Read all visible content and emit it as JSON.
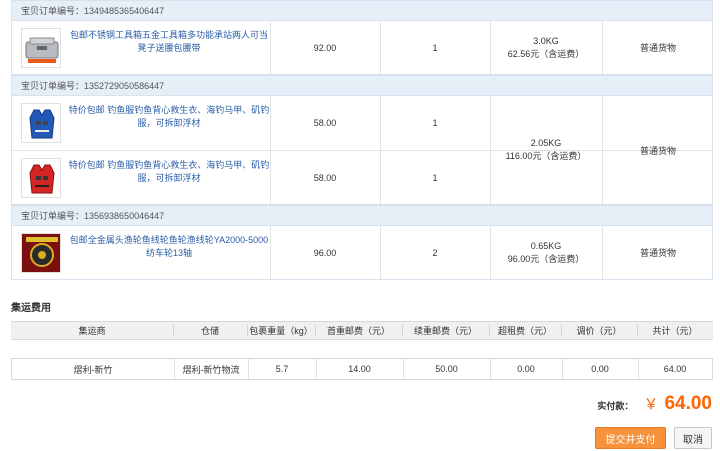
{
  "order_label": "宝贝订单编号：",
  "orders": [
    {
      "number": "1349485365406447",
      "items": [
        {
          "title": "包邮不锈钢工具箱五金工具箱多功能承站两人可当凳子送腰包腰带",
          "price": "92.00",
          "qty": "1",
          "icon": "toolbox-icon"
        }
      ],
      "weight": "3.0KG",
      "cost": "62.56元（含运费）",
      "type": "普通货物"
    },
    {
      "number": "1352729050586447",
      "items": [
        {
          "title": "特价包邮 钓鱼服钓鱼背心救生衣、海钓马甲、矶钓服，可拆卸浮材",
          "price": "58.00",
          "qty": "1",
          "icon": "blue-life-vest-icon"
        },
        {
          "title": "特价包邮 钓鱼服钓鱼背心救生衣、海钓马甲、矶钓服，可拆卸浮材",
          "price": "58.00",
          "qty": "1",
          "icon": "red-life-vest-icon"
        }
      ],
      "weight": "2.05KG",
      "cost": "116.00元（含运费）",
      "type": "普通货物"
    },
    {
      "number": "1356938650046447",
      "items": [
        {
          "title": "包邮全金属头渔轮鱼线轮鱼轮渔线轮YA2000-5000纺车轮13轴",
          "price": "96.00",
          "qty": "2",
          "icon": "fishing-reel-icon"
        }
      ],
      "weight": "0.65KG",
      "cost": "96.00元（含运费）",
      "type": "普通货物"
    }
  ],
  "fees": {
    "title": "集运费用",
    "headers": [
      "集运商",
      "仓储",
      "包裹重量（kg）",
      "首重邮费（元）",
      "续重邮费（元）",
      "超租费（元）",
      "调价（元）",
      "共计（元）"
    ],
    "row": [
      "熠利-新竹",
      "熠利-新竹物流",
      "5.7",
      "14.00",
      "50.00",
      "0.00",
      "0.00",
      "64.00"
    ]
  },
  "payment": {
    "label": "实付款：",
    "currency": "￥",
    "amount": "64.00"
  },
  "buttons": {
    "submit": "提交并支付",
    "cancel": "取消"
  },
  "colors": {
    "accent": "#ff6600",
    "button": "#f7913a",
    "link": "#2a5ea8",
    "header_bg": "#e6eff8"
  }
}
